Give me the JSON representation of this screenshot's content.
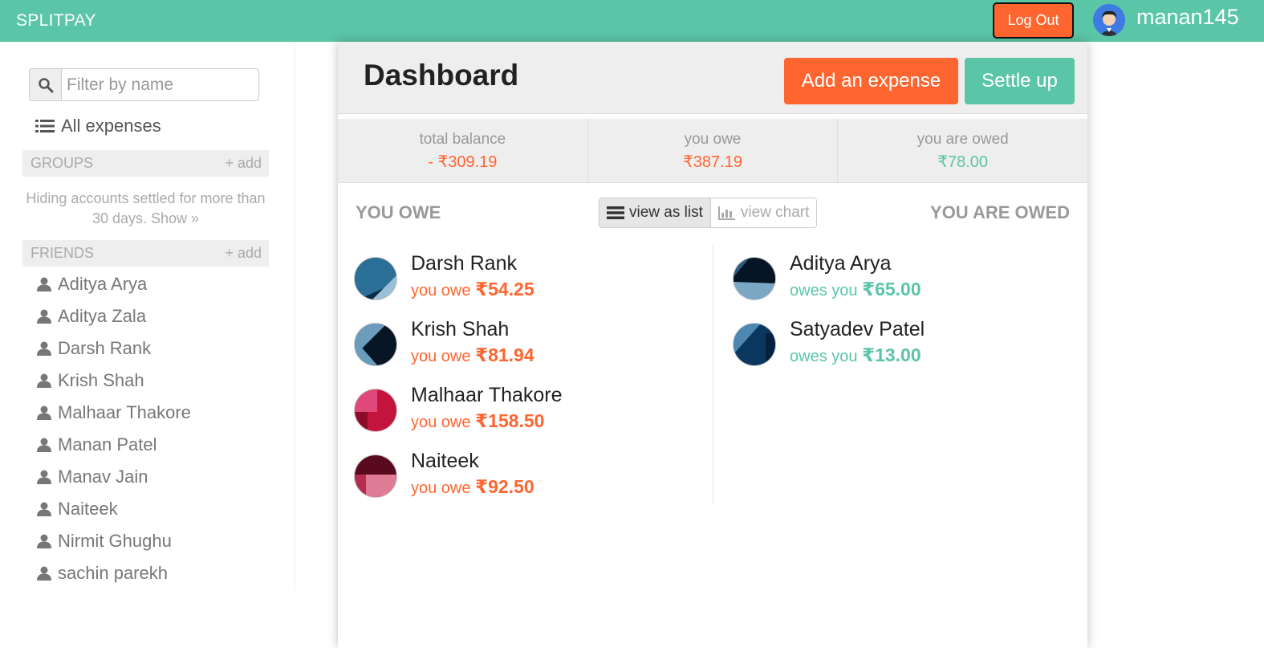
{
  "app": {
    "brand": "SPLITPAY",
    "logout_label": "Log Out",
    "username": "manan145"
  },
  "sidebar": {
    "filter_placeholder": "Filter by name",
    "all_expenses_label": "All expenses",
    "groups_label": "GROUPS",
    "groups_add_label": "+ add",
    "hiding_text": "Hiding accounts settled for more than 30 days. Show »",
    "friends_label": "FRIENDS",
    "friends_add_label": "+ add",
    "friends": [
      "Aditya Arya",
      "Aditya Zala",
      "Darsh Rank",
      "Krish Shah",
      "Malhaar Thakore",
      "Manan Patel",
      "Manav Jain",
      "Naiteek",
      "Nirmit Ghughu",
      "sachin parekh"
    ]
  },
  "dashboard": {
    "title": "Dashboard",
    "add_expense_label": "Add an expense",
    "settle_up_label": "Settle up",
    "balances": {
      "total_label": "total balance",
      "total_value": "- ₹309.19",
      "owe_label": "you owe",
      "owe_value": "₹387.19",
      "owed_label": "you are owed",
      "owed_value": "₹78.00"
    },
    "you_owe_heading": "YOU OWE",
    "you_are_owed_heading": "YOU ARE OWED",
    "view_list_label": "view as list",
    "view_chart_label": "view chart",
    "you_owe": [
      {
        "name": "Darsh Rank",
        "prefix": "you owe",
        "amount": "₹54.25"
      },
      {
        "name": "Krish Shah",
        "prefix": "you owe",
        "amount": "₹81.94"
      },
      {
        "name": "Malhaar Thakore",
        "prefix": "you owe",
        "amount": "₹158.50"
      },
      {
        "name": "Naiteek",
        "prefix": "you owe",
        "amount": "₹92.50"
      }
    ],
    "owed_to_you": [
      {
        "name": "Aditya Arya",
        "prefix": "owes you",
        "amount": "₹65.00"
      },
      {
        "name": "Satyadev Patel",
        "prefix": "owes you",
        "amount": "₹13.00"
      }
    ]
  },
  "colors": {
    "brand_green": "#5bc5a7",
    "accent_orange": "#ff652f"
  }
}
